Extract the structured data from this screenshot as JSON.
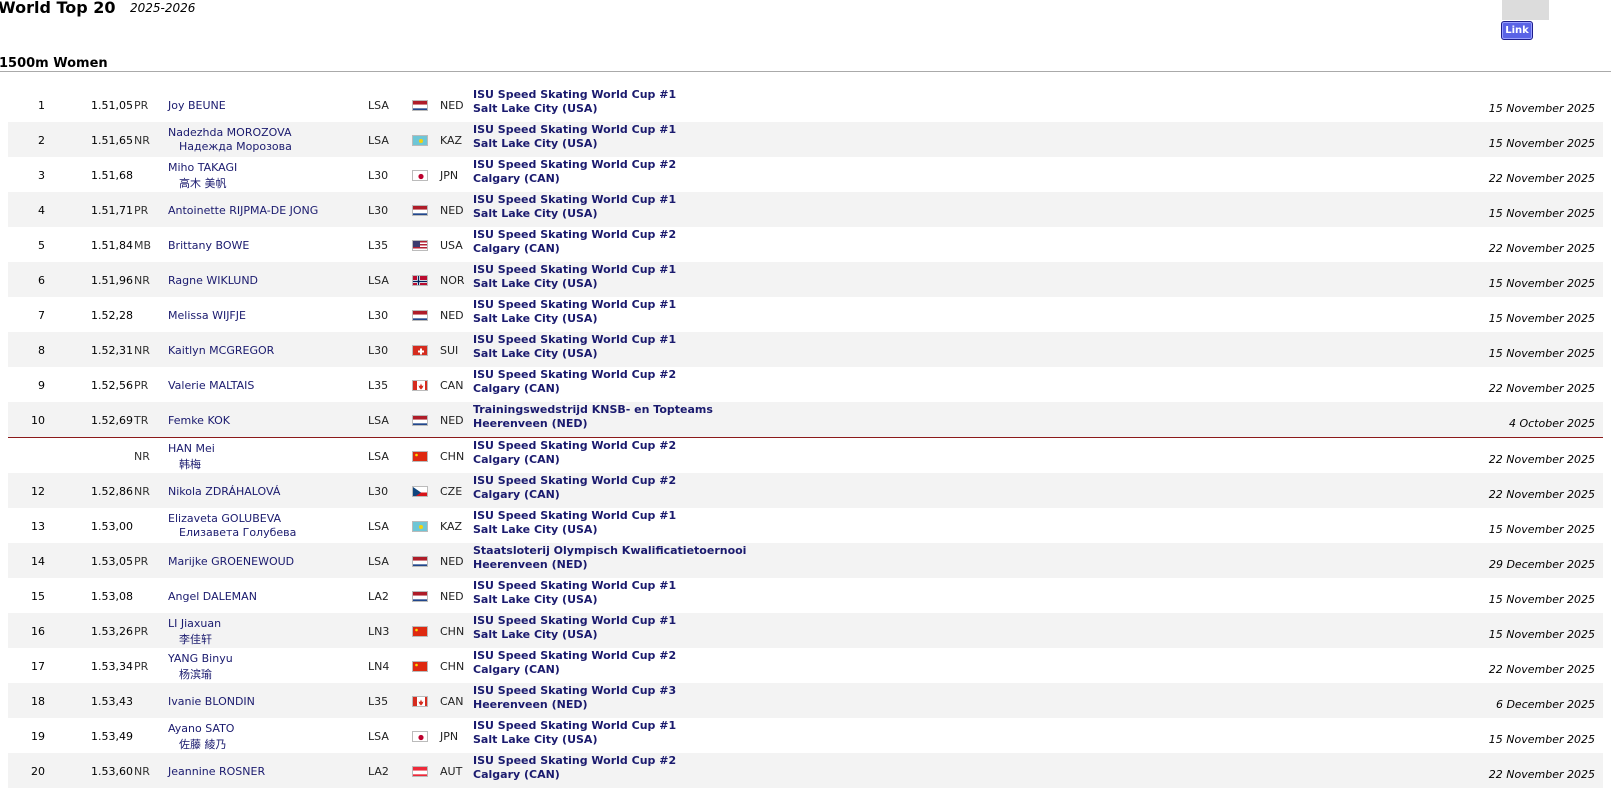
{
  "header": {
    "title": "World Top 20",
    "season": "2025-2026",
    "link_label": "Link",
    "distance": "1500m Women"
  },
  "rows": [
    {
      "rank": "1",
      "time": "1.51,05",
      "rec": "PR",
      "name": "Joy BEUNE",
      "name2": "",
      "cat": "LSA",
      "flag": "NED",
      "nat": "NED",
      "comp": "ISU Speed Skating World Cup #1",
      "venue": "Salt Lake City (USA)",
      "date": "15 November 2025"
    },
    {
      "rank": "2",
      "time": "1.51,65",
      "rec": "NR",
      "name": "Nadezhda MOROZOVA",
      "name2": "Надежда Морозова",
      "cat": "LSA",
      "flag": "KAZ",
      "nat": "KAZ",
      "comp": "ISU Speed Skating World Cup #1",
      "venue": "Salt Lake City (USA)",
      "date": "15 November 2025"
    },
    {
      "rank": "3",
      "time": "1.51,68",
      "rec": "",
      "name": "Miho TAKAGI",
      "name2": "高木 美帆",
      "cat": "L30",
      "flag": "JPN",
      "nat": "JPN",
      "comp": "ISU Speed Skating World Cup #2",
      "venue": "Calgary (CAN)",
      "date": "22 November 2025"
    },
    {
      "rank": "4",
      "time": "1.51,71",
      "rec": "PR",
      "name": "Antoinette RIJPMA-DE JONG",
      "name2": "",
      "cat": "L30",
      "flag": "NED",
      "nat": "NED",
      "comp": "ISU Speed Skating World Cup #1",
      "venue": "Salt Lake City (USA)",
      "date": "15 November 2025"
    },
    {
      "rank": "5",
      "time": "1.51,84",
      "rec": "MB",
      "name": "Brittany BOWE",
      "name2": "",
      "cat": "L35",
      "flag": "USA",
      "nat": "USA",
      "comp": "ISU Speed Skating World Cup #2",
      "venue": "Calgary (CAN)",
      "date": "22 November 2025"
    },
    {
      "rank": "6",
      "time": "1.51,96",
      "rec": "NR",
      "name": "Ragne WIKLUND",
      "name2": "",
      "cat": "LSA",
      "flag": "NOR",
      "nat": "NOR",
      "comp": "ISU Speed Skating World Cup #1",
      "venue": "Salt Lake City (USA)",
      "date": "15 November 2025"
    },
    {
      "rank": "7",
      "time": "1.52,28",
      "rec": "",
      "name": "Melissa WIJFJE",
      "name2": "",
      "cat": "L30",
      "flag": "NED",
      "nat": "NED",
      "comp": "ISU Speed Skating World Cup #1",
      "venue": "Salt Lake City (USA)",
      "date": "15 November 2025"
    },
    {
      "rank": "8",
      "time": "1.52,31",
      "rec": "NR",
      "name": "Kaitlyn MCGREGOR",
      "name2": "",
      "cat": "L30",
      "flag": "SUI",
      "nat": "SUI",
      "comp": "ISU Speed Skating World Cup #1",
      "venue": "Salt Lake City (USA)",
      "date": "15 November 2025"
    },
    {
      "rank": "9",
      "time": "1.52,56",
      "rec": "PR",
      "name": "Valerie MALTAIS",
      "name2": "",
      "cat": "L35",
      "flag": "CAN",
      "nat": "CAN",
      "comp": "ISU Speed Skating World Cup #2",
      "venue": "Calgary (CAN)",
      "date": "22 November 2025"
    },
    {
      "rank": "10",
      "time": "1.52,69",
      "rec": "TR",
      "name": "Femke KOK",
      "name2": "",
      "cat": "LSA",
      "flag": "NED",
      "nat": "NED",
      "comp": "Trainingswedstrijd KNSB- en Topteams",
      "venue": "Heerenveen (NED)",
      "date": "4 October 2025"
    },
    {
      "rank": "",
      "time": "",
      "rec": "NR",
      "name": "HAN Mei",
      "name2": "韩梅",
      "cat": "LSA",
      "flag": "CHN",
      "nat": "CHN",
      "comp": "ISU Speed Skating World Cup #2",
      "venue": "Calgary (CAN)",
      "date": "22 November 2025",
      "tie": true
    },
    {
      "rank": "12",
      "time": "1.52,86",
      "rec": "NR",
      "name": "Nikola ZDRÁHALOVÁ",
      "name2": "",
      "cat": "L30",
      "flag": "CZE",
      "nat": "CZE",
      "comp": "ISU Speed Skating World Cup #2",
      "venue": "Calgary (CAN)",
      "date": "22 November 2025"
    },
    {
      "rank": "13",
      "time": "1.53,00",
      "rec": "",
      "name": "Elizaveta GOLUBEVA",
      "name2": "Елизавета Голубева",
      "cat": "LSA",
      "flag": "KAZ",
      "nat": "KAZ",
      "comp": "ISU Speed Skating World Cup #1",
      "venue": "Salt Lake City (USA)",
      "date": "15 November 2025"
    },
    {
      "rank": "14",
      "time": "1.53,05",
      "rec": "PR",
      "name": "Marijke GROENEWOUD",
      "name2": "",
      "cat": "LSA",
      "flag": "NED",
      "nat": "NED",
      "comp": "Staatsloterij Olympisch Kwalificatietoernooi",
      "venue": "Heerenveen (NED)",
      "date": "29 December 2025"
    },
    {
      "rank": "15",
      "time": "1.53,08",
      "rec": "",
      "name": "Angel DALEMAN",
      "name2": "",
      "cat": "LA2",
      "flag": "NED",
      "nat": "NED",
      "comp": "ISU Speed Skating World Cup #1",
      "venue": "Salt Lake City (USA)",
      "date": "15 November 2025"
    },
    {
      "rank": "16",
      "time": "1.53,26",
      "rec": "PR",
      "name": "LI Jiaxuan",
      "name2": "李佳轩",
      "cat": "LN3",
      "flag": "CHN",
      "nat": "CHN",
      "comp": "ISU Speed Skating World Cup #1",
      "venue": "Salt Lake City (USA)",
      "date": "15 November 2025"
    },
    {
      "rank": "17",
      "time": "1.53,34",
      "rec": "PR",
      "name": "YANG Binyu",
      "name2": "杨滨瑜",
      "cat": "LN4",
      "flag": "CHN",
      "nat": "CHN",
      "comp": "ISU Speed Skating World Cup #2",
      "venue": "Calgary (CAN)",
      "date": "22 November 2025"
    },
    {
      "rank": "18",
      "time": "1.53,43",
      "rec": "",
      "name": "Ivanie BLONDIN",
      "name2": "",
      "cat": "L35",
      "flag": "CAN",
      "nat": "CAN",
      "comp": "ISU Speed Skating World Cup #3",
      "venue": "Heerenveen (NED)",
      "date": "6 December 2025"
    },
    {
      "rank": "19",
      "time": "1.53,49",
      "rec": "",
      "name": "Ayano SATO",
      "name2": "佐藤 綾乃",
      "cat": "LSA",
      "flag": "JPN",
      "nat": "JPN",
      "comp": "ISU Speed Skating World Cup #1",
      "venue": "Salt Lake City (USA)",
      "date": "15 November 2025"
    },
    {
      "rank": "20",
      "time": "1.53,60",
      "rec": "NR",
      "name": "Jeannine ROSNER",
      "name2": "",
      "cat": "LA2",
      "flag": "AUT",
      "nat": "AUT",
      "comp": "ISU Speed Skating World Cup #2",
      "venue": "Calgary (CAN)",
      "date": "22 November 2025"
    }
  ]
}
